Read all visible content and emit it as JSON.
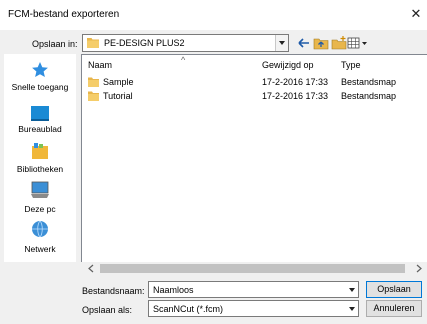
{
  "dialog": {
    "title": "FCM-bestand exporteren",
    "close_glyph": "✕"
  },
  "toolbar": {
    "save_in_label": "Opslaan in:",
    "location": "PE-DESIGN PLUS2",
    "icons": [
      "back-arrow-icon",
      "up-folder-icon",
      "new-folder-icon",
      "view-menu-icon"
    ]
  },
  "places": [
    {
      "label": "Snelle toegang",
      "icon": "star-icon"
    },
    {
      "label": "Bureaublad",
      "icon": "desktop-icon"
    },
    {
      "label": "Bibliotheken",
      "icon": "library-icon"
    },
    {
      "label": "Deze pc",
      "icon": "computer-icon"
    },
    {
      "label": "Netwerk",
      "icon": "network-icon"
    }
  ],
  "filelist": {
    "columns": {
      "name": "Naam",
      "modified": "Gewijzigd op",
      "type": "Type"
    },
    "sort_glyph": "^",
    "items": [
      {
        "name": "Sample",
        "modified": "17-2-2016 17:33",
        "type": "Bestandsmap"
      },
      {
        "name": "Tutorial",
        "modified": "17-2-2016 17:33",
        "type": "Bestandsmap"
      }
    ]
  },
  "form": {
    "filename_label": "Bestandsnaam:",
    "filename_value": "Naamloos",
    "filetype_label": "Opslaan als:",
    "filetype_value": "ScanNCut (*.fcm)"
  },
  "buttons": {
    "save": "Opslaan",
    "cancel": "Annuleren"
  },
  "colors": {
    "folder": "#e8b64c",
    "accent": "#0078d7"
  }
}
